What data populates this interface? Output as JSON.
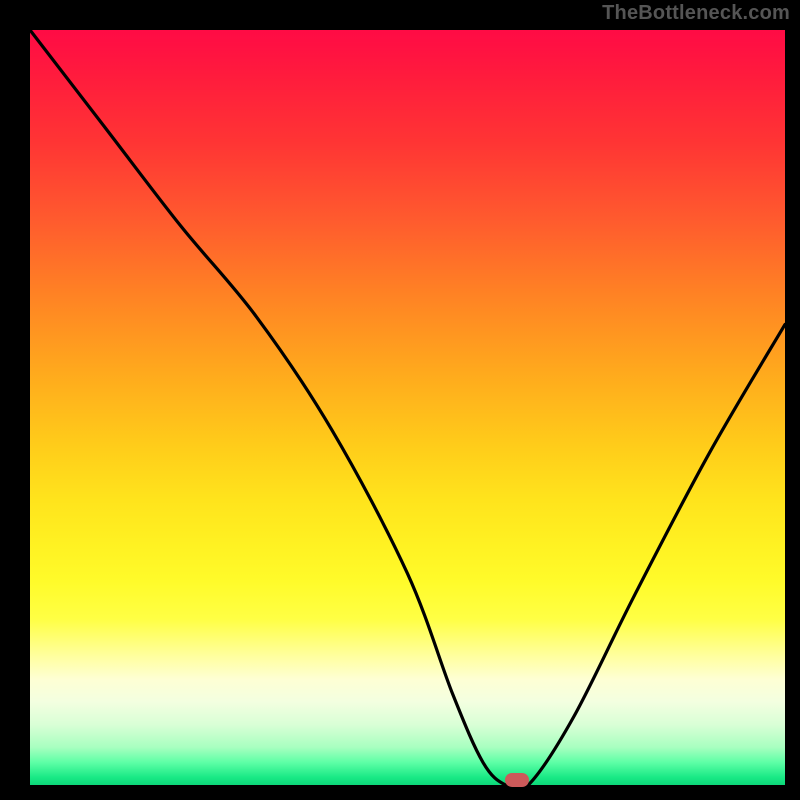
{
  "watermark": "TheBottleneck.com",
  "chart_data": {
    "type": "line",
    "title": "",
    "xlabel": "",
    "ylabel": "",
    "xlim": [
      0,
      100
    ],
    "ylim": [
      0,
      100
    ],
    "series": [
      {
        "name": "bottleneck-curve",
        "x": [
          0,
          10,
          20,
          30,
          40,
          50,
          56,
          60,
          63,
          66,
          72,
          80,
          90,
          100
        ],
        "values": [
          100,
          87,
          74,
          62,
          47,
          28,
          12,
          3,
          0,
          0,
          9,
          25,
          44,
          61
        ]
      }
    ],
    "minimum_marker": {
      "x": 64.5,
      "y": 0
    },
    "colors": {
      "curve": "#000000",
      "marker": "#cc5a5a",
      "gradient_top": "#ff0b45",
      "gradient_bottom": "#0dd779",
      "frame": "#000000"
    }
  }
}
